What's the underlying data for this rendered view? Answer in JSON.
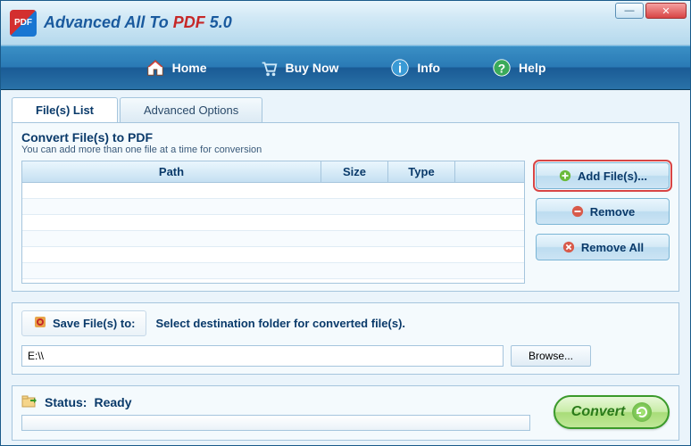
{
  "app": {
    "title_part1": "Advanced All To ",
    "title_part2": "PDF ",
    "title_part3": "5.0"
  },
  "menu": {
    "home": "Home",
    "buy": "Buy Now",
    "info": "Info",
    "help": "Help"
  },
  "tabs": {
    "files": "File(s) List",
    "advanced": "Advanced Options"
  },
  "filesPanel": {
    "title": "Convert File(s) to PDF",
    "subtitle": "You can add more than one file at a time for conversion",
    "columns": {
      "path": "Path",
      "size": "Size",
      "type": "Type"
    }
  },
  "buttons": {
    "add": "Add File(s)...",
    "remove": "Remove",
    "removeAll": "Remove All",
    "browse": "Browse...",
    "convert": "Convert"
  },
  "dest": {
    "label": "Save File(s) to:",
    "hint": "Select destination folder for converted file(s).",
    "value": "E:\\\\"
  },
  "status": {
    "label": "Status:",
    "value": "Ready"
  },
  "colors": {
    "accent": "#1a5a9e",
    "danger": "#c62828",
    "success": "#3a9a2a"
  }
}
